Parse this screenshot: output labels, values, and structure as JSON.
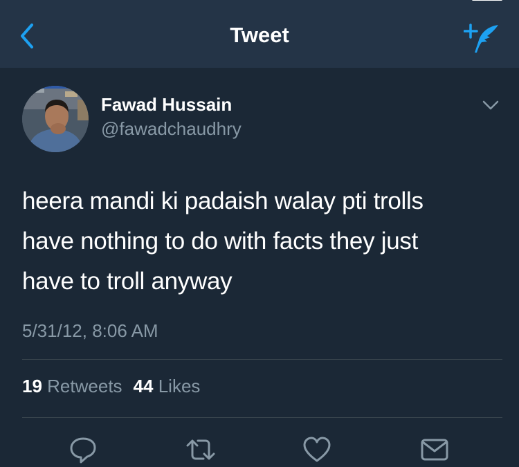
{
  "navbar": {
    "title": "Tweet",
    "back_icon": "chevron-left-icon",
    "compose_icon": "compose-tweet-icon",
    "background": "#243447",
    "accent": "#1da1f2"
  },
  "tweet": {
    "author": {
      "display_name": "Fawad Hussain",
      "handle": "@fawadchaudhry"
    },
    "text_lines": [
      "heera mandi ki padaish walay pti trolls",
      "have nothing to do with facts they just",
      "have to troll anyway"
    ],
    "timestamp": "5/31/12, 8:06 AM",
    "stats": {
      "retweets_count": "19",
      "retweets_label": "Retweets",
      "likes_count": "44",
      "likes_label": "Likes"
    },
    "actions": [
      "reply-icon",
      "retweet-icon",
      "like-icon",
      "direct-message-icon"
    ]
  },
  "colors": {
    "background": "#1b2836",
    "text_primary": "#ffffff",
    "text_secondary": "#8899a6",
    "divider": "#38444d"
  }
}
